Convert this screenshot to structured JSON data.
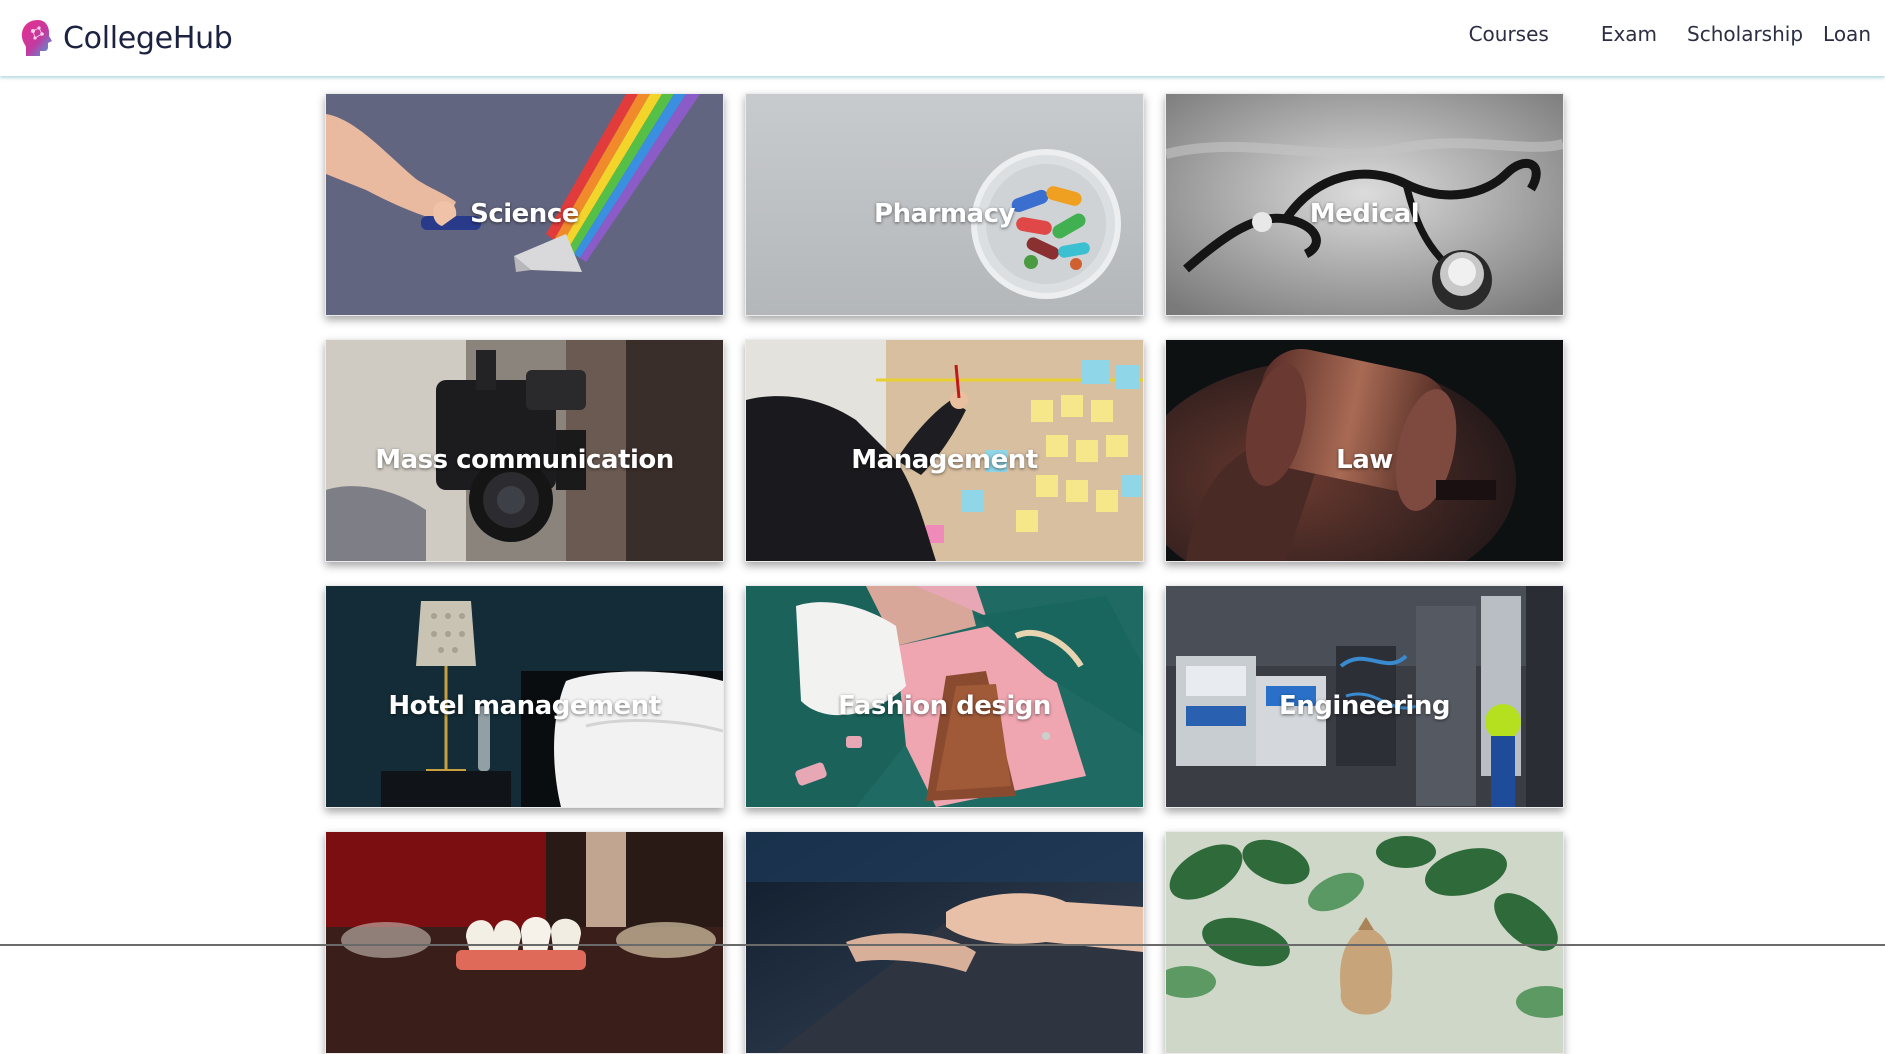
{
  "brand": {
    "name": "CollegeHub",
    "logo_icon": "brain-head-logo-icon"
  },
  "nav": {
    "links": [
      "Courses",
      "Exam",
      "Scholarship",
      "Loan"
    ]
  },
  "courses": [
    {
      "label": "Science",
      "image": "prism-rainbow-image"
    },
    {
      "label": "Pharmacy",
      "image": "pill-capsules-bowl-image"
    },
    {
      "label": "Medical",
      "image": "stethoscope-image"
    },
    {
      "label": "Mass communication",
      "image": "video-camera-image"
    },
    {
      "label": "Management",
      "image": "sticky-notes-board-image"
    },
    {
      "label": "Law",
      "image": "gavel-image"
    },
    {
      "label": "Hotel management",
      "image": "hotel-room-bed-image"
    },
    {
      "label": "Fashion design",
      "image": "clothing-flatlay-image"
    },
    {
      "label": "Engineering",
      "image": "industrial-machinery-image"
    },
    {
      "label": "",
      "image": "dental-teeth-model-image"
    },
    {
      "label": "",
      "image": "typing-keyboard-image"
    },
    {
      "label": "",
      "image": "money-bag-plant-image"
    }
  ]
}
